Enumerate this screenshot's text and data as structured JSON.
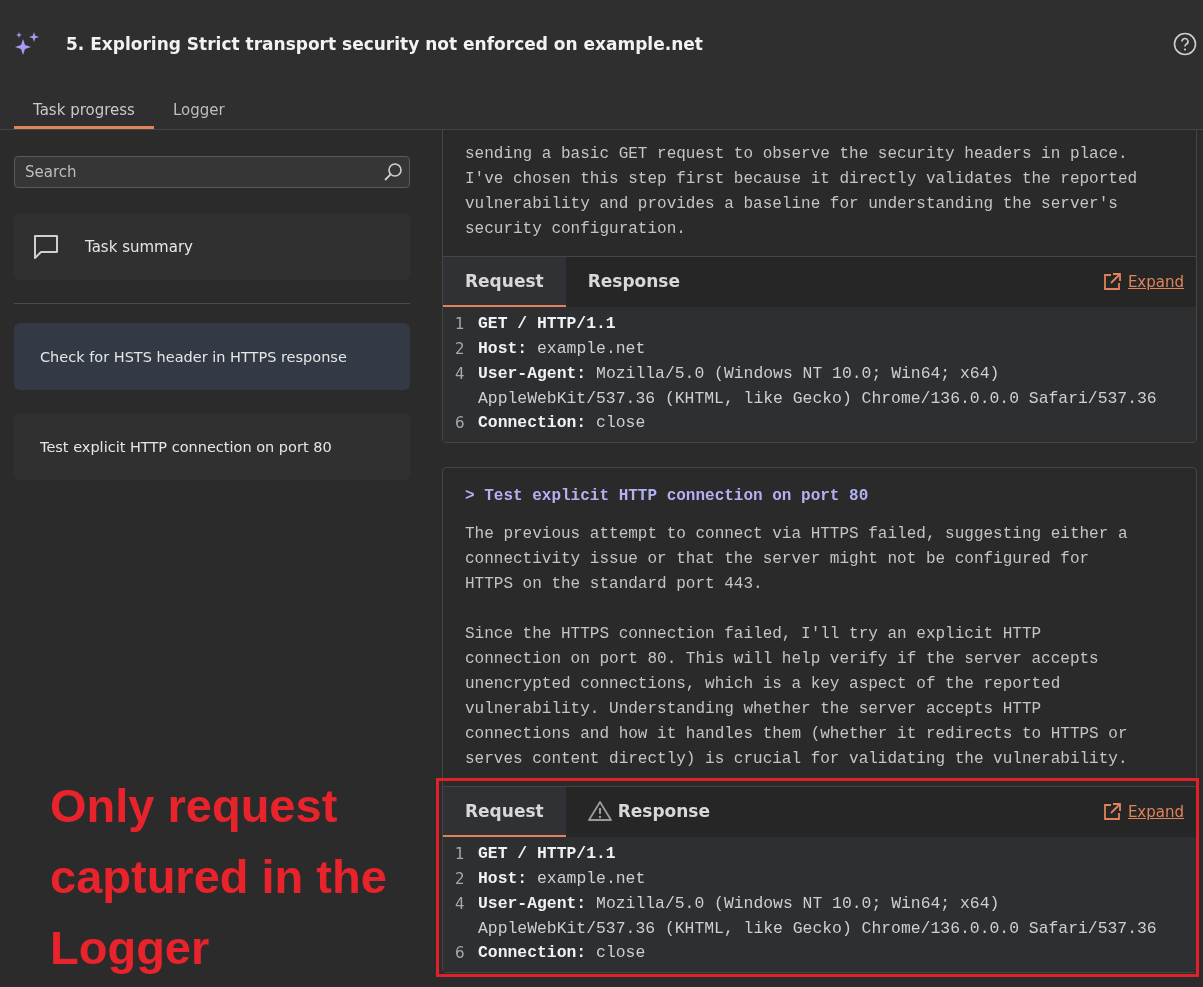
{
  "header": {
    "title": "5. Exploring Strict transport security not enforced on example.net"
  },
  "tabs": [
    {
      "label": "Task progress",
      "selected": true
    },
    {
      "label": "Logger",
      "selected": false
    }
  ],
  "search": {
    "placeholder": "Search"
  },
  "task_summary": {
    "label": "Task summary"
  },
  "steps": [
    {
      "label": "Check for HSTS header in HTTPS response",
      "selected": true
    },
    {
      "label": "Test explicit HTTP connection on port 80",
      "selected": false
    }
  ],
  "log": [
    {
      "paragraphs": [
        "sending a basic GET request to observe the security headers in place. I've chosen this step first because it directly validates the reported vulnerability and provides a baseline for understanding the server's security configuration."
      ],
      "request": {
        "tabs": [
          {
            "label": "Request",
            "selected": true,
            "warning": false
          },
          {
            "label": "Response",
            "selected": false,
            "warning": false
          }
        ],
        "expand": "Expand",
        "lines": [
          {
            "number": "1",
            "value": "GET / HTTP/1.1"
          },
          {
            "number": "2",
            "key": "Host:",
            "value": "example.net"
          },
          {
            "number": "4",
            "key": "User-Agent:",
            "value": "Mozilla/5.0 (Windows NT 10.0; Win64; x64)"
          },
          {
            "value": "AppleWebKit/537.36 (KHTML, like Gecko) Chrome/136.0.0.0 Safari/537.36"
          },
          {
            "number": "6",
            "key": "Connection:",
            "value": "close"
          }
        ]
      }
    },
    {
      "heading": "> Test explicit HTTP connection on port 80",
      "paragraphs": [
        "The previous attempt to connect via HTTPS failed, suggesting either a connectivity issue or that the server might not be configured for HTTPS on the standard port 443.",
        "Since the HTTPS connection failed, I'll try an explicit HTTP connection on port 80. This will help verify if the server accepts unencrypted connections, which is a key aspect of the reported vulnerability. Understanding whether the server accepts HTTP connections and how it handles them (whether it redirects to HTTPS or serves content directly) is crucial for validating the vulnerability."
      ],
      "request": {
        "tabs": [
          {
            "label": "Request",
            "selected": true,
            "warning": false
          },
          {
            "label": "Response",
            "selected": false,
            "warning": true
          }
        ],
        "expand": "Expand",
        "lines": [
          {
            "number": "1",
            "value": "GET / HTTP/1.1"
          },
          {
            "number": "2",
            "key": "Host:",
            "value": "example.net"
          },
          {
            "number": "4",
            "key": "User-Agent:",
            "value": "Mozilla/5.0 (Windows NT 10.0; Win64; x64)"
          },
          {
            "value": "AppleWebKit/537.36 (KHTML, like Gecko) Chrome/136.0.0.0 Safari/537.36"
          },
          {
            "number": "6",
            "key": "Connection:",
            "value": "close"
          }
        ]
      }
    }
  ],
  "annotation": {
    "text": "Only request captured in the Logger",
    "highlight": true
  }
}
